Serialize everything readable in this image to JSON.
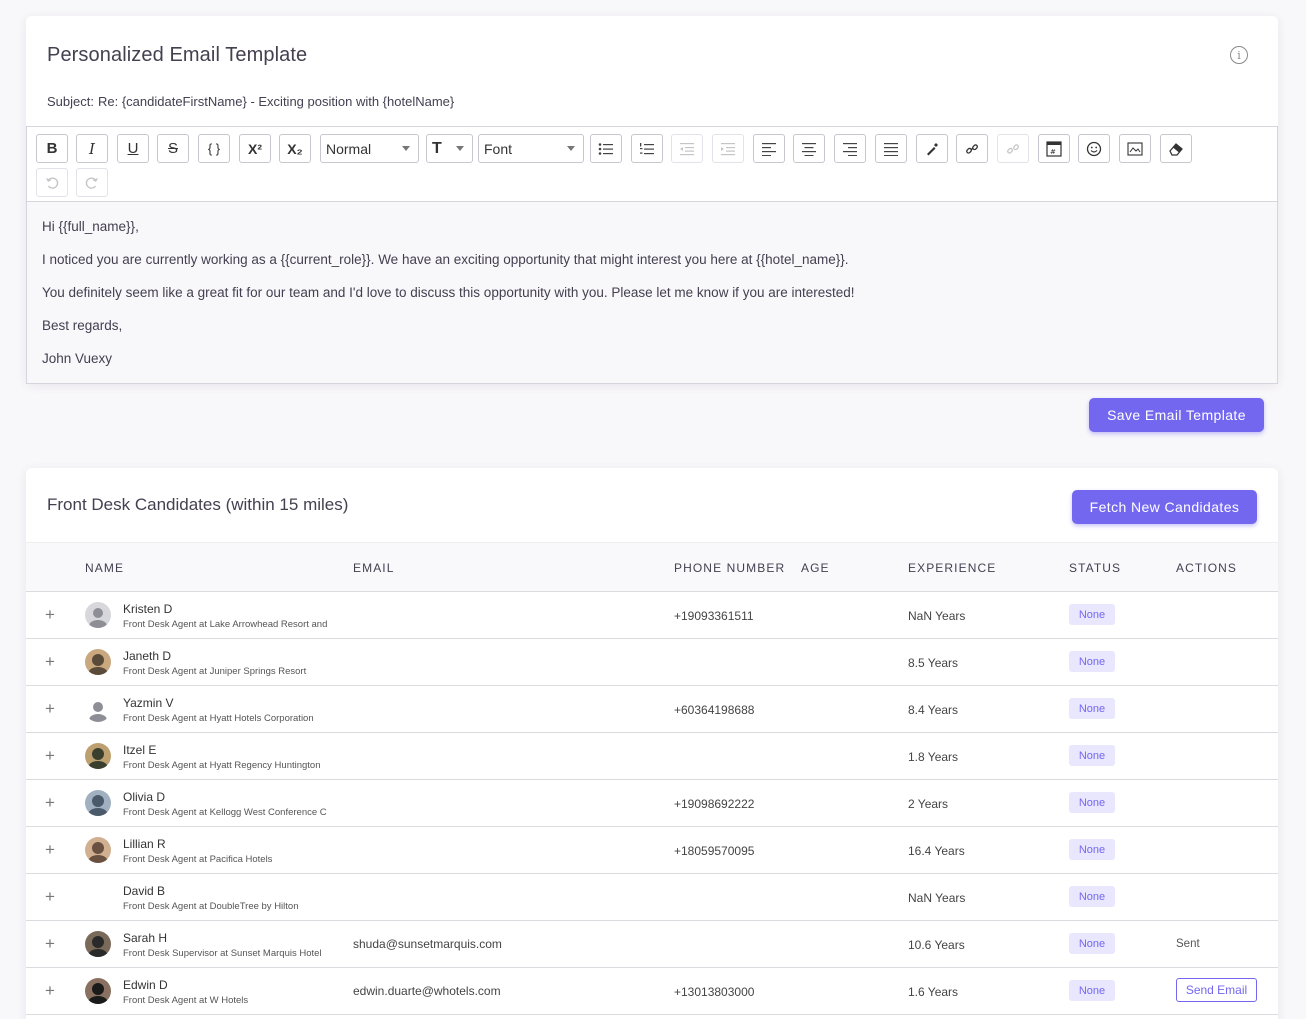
{
  "email_template": {
    "title": "Personalized Email Template",
    "subject_label": "Subject:",
    "subject_value": "Re: {candidateFirstName} - Exciting position with {hotelName}",
    "toolbar": {
      "bold": "B",
      "italic": "I",
      "underline": "U",
      "strike": "S",
      "code": "{ }",
      "superscript": "X²",
      "subscript": "X₂",
      "heading_select": "Normal",
      "size_select": "T",
      "font_select": "Font"
    },
    "body": [
      "Hi {{full_name}},",
      "I noticed you are currently working as a {{current_role}}. We have an exciting opportunity that might interest you here at {{hotel_name}}.",
      "You definitely seem like a great fit for our team and I'd love to discuss this opportunity with you. Please let me know if you are interested!",
      "Best regards,",
      "John Vuexy"
    ],
    "save_label": "Save Email Template"
  },
  "candidates": {
    "title": "Front Desk Candidates (within 15 miles)",
    "fetch_label": "Fetch New Candidates",
    "columns": [
      "NAME",
      "EMAIL",
      "PHONE NUMBER",
      "AGE",
      "EXPERIENCE",
      "STATUS",
      "ACTIONS"
    ],
    "rows": [
      {
        "name": "Kristen D",
        "role": "Front Desk Agent at Lake Arrowhead Resort and",
        "email": "",
        "phone": "+19093361511",
        "experience": "NaN Years",
        "status": "None",
        "action": "",
        "avatar": "placeholder"
      },
      {
        "name": "Janeth D",
        "role": "Front Desk Agent at Juniper Springs Resort",
        "email": "",
        "phone": "",
        "experience": "8.5 Years",
        "status": "None",
        "action": "",
        "avatar": "photo"
      },
      {
        "name": "Yazmin V",
        "role": "Front Desk Agent at Hyatt Hotels Corporation",
        "email": "",
        "phone": "+60364198688",
        "experience": "8.4 Years",
        "status": "None",
        "action": "",
        "avatar": "placeholder-plain"
      },
      {
        "name": "Itzel E",
        "role": "Front Desk Agent at Hyatt Regency Huntington",
        "email": "",
        "phone": "",
        "experience": "1.8 Years",
        "status": "None",
        "action": "",
        "avatar": "photo"
      },
      {
        "name": "Olivia D",
        "role": "Front Desk Agent at Kellogg West Conference C",
        "email": "",
        "phone": "+19098692222",
        "experience": "2 Years",
        "status": "None",
        "action": "",
        "avatar": "photo"
      },
      {
        "name": "Lillian R",
        "role": "Front Desk Agent at Pacifica Hotels",
        "email": "",
        "phone": "+18059570095",
        "experience": "16.4 Years",
        "status": "None",
        "action": "",
        "avatar": "photo"
      },
      {
        "name": "David B",
        "role": "Front Desk Agent at DoubleTree by Hilton",
        "email": "",
        "phone": "",
        "experience": "NaN Years",
        "status": "None",
        "action": "",
        "avatar": "none"
      },
      {
        "name": "Sarah H",
        "role": "Front Desk Supervisor at Sunset Marquis Hotel",
        "email": "shuda@sunsetmarquis.com",
        "phone": "",
        "experience": "10.6 Years",
        "status": "None",
        "action": "Sent",
        "avatar": "photo"
      },
      {
        "name": "Edwin D",
        "role": "Front Desk Agent at W Hotels",
        "email": "edwin.duarte@whotels.com",
        "phone": "+13013803000",
        "experience": "1.6 Years",
        "status": "None",
        "action": "Send Email",
        "avatar": "photo"
      }
    ]
  },
  "colors": {
    "primary": "#7367f0",
    "badge_bg": "#e9e7fd"
  }
}
